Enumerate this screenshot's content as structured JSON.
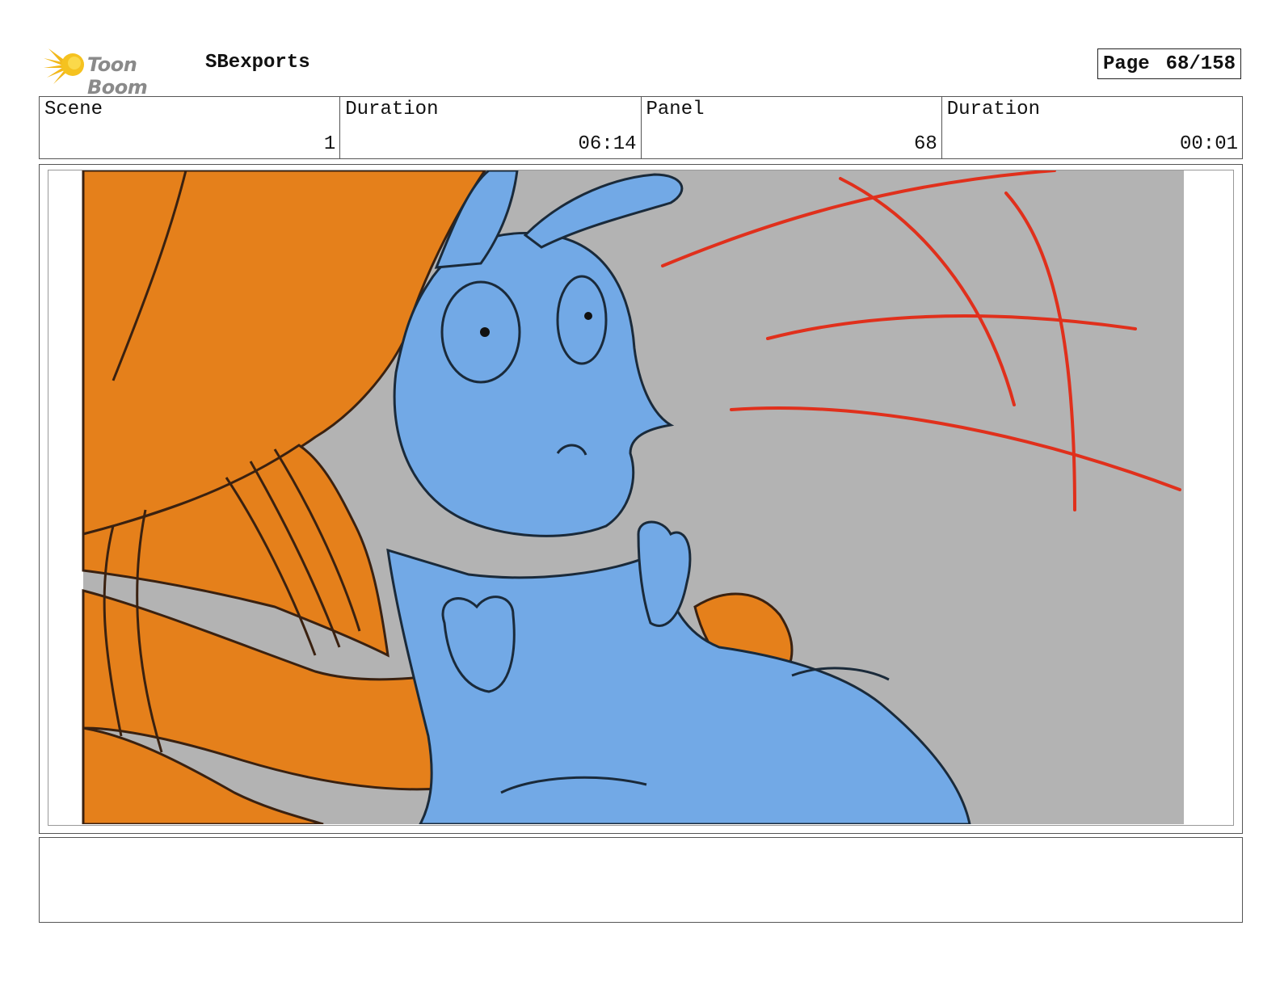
{
  "header": {
    "logo_text": "Toon Boom",
    "project": "SBexports",
    "page_label": "Page",
    "page_value": "68/158"
  },
  "info": {
    "scene_label": "Scene",
    "scene_value": "1",
    "scene_duration_label": "Duration",
    "scene_duration_value": "06:14",
    "panel_label": "Panel",
    "panel_value": "68",
    "panel_duration_label": "Duration",
    "panel_duration_value": "00:01"
  },
  "colors": {
    "orange": "#e5801b",
    "blue": "#72a9e6",
    "background_gray": "#b3b3b3",
    "red_lines": "#e0301c",
    "ink": "#1a2a3a"
  },
  "notes": ""
}
